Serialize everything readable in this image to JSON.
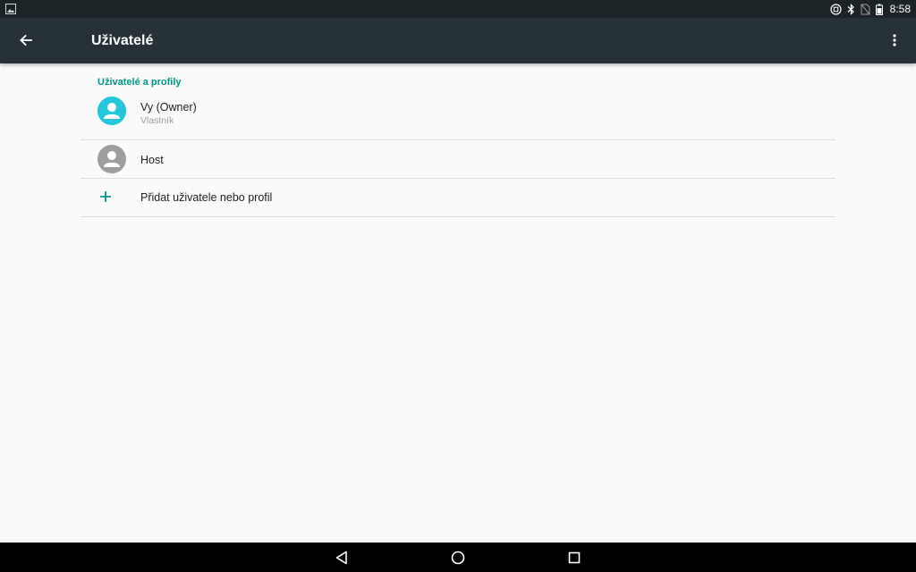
{
  "status_bar": {
    "time": "8:58",
    "icons": [
      "image-notification-icon",
      "sync-icon",
      "bluetooth-icon",
      "no-sim-icon",
      "battery-icon"
    ]
  },
  "app_bar": {
    "title": "Uživatelé",
    "colors": {
      "background": "#263238",
      "status": "#1c2326"
    }
  },
  "users_section": {
    "header": "Uživatelé a profily",
    "accent": "#009688",
    "items": [
      {
        "name": "Vy (Owner)",
        "subtitle": "Vlastník",
        "avatar_color": "#26c6da",
        "icon": "person-avatar-icon"
      },
      {
        "name": "Host",
        "avatar_color": "#9e9e9e",
        "icon": "person-avatar-icon"
      }
    ],
    "add_label": "Přidat uživatele nebo profil"
  },
  "nav_bar": {
    "buttons": [
      "back-icon",
      "home-icon",
      "recents-icon"
    ]
  }
}
